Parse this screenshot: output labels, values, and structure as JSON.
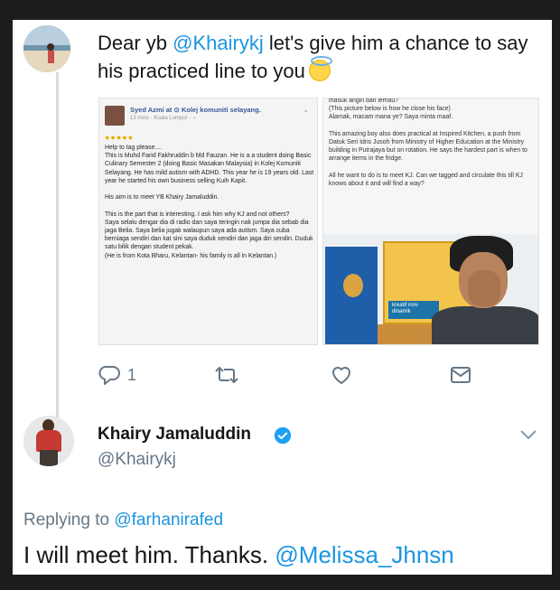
{
  "reply": {
    "text_before": "Dear yb ",
    "mention": "@Khairykj",
    "text_after": " let's give him a chance to say his practiced line to you"
  },
  "screenshot_left": {
    "author": "Syed Azmi at ⊙ Kolej komuniti selayang.",
    "meta": "13 mins · Kuala Lumpur · ♁",
    "body": "Help to tag please....\nThis is Muhd Farid Fakhruddin b Md Fauzan. He is a a student doing Basic Culinary Semester 2 (doing Basic Masakan Malaysia) in Kolej Komuniti Selayang. He has mild autism with ADHD. This year he is 19 years old. Last year he started his own business selling Kuih Kapit.\n\nHis aim is to meet YB Khairy Jamaluddin.\n\nThis is the part that is interesting. I ask him why KJ and not others?\nSaya selalu dengar dia di radio dan saya teringin nak jumpa dia sebab dia jaga Belia. Saya belia jugak walaupun saya ada autism. Saya cuba berniaga sendiri dan kat sini saya duduk sendiri dan jaga diri sendiri. Duduk satu bilik dengan student pekak.\n(He is from Kota Bharu, Kelantan- his family is all in Kelantan.)"
  },
  "screenshot_right": {
    "body": "masuk angin dan lemau?\n(This picture below is how he close his face)\nAlamak, macam mana ye? Saya minta maaf.\n\nThis amazing boy also does practical at Inspired Kitchen, a push from Datuk Seri Idris Jusoh from Ministry of Higher Education at the Ministry building in Putrajaya but on rotation. He says the hardest part is when to arrange items in the fridge.\n\nAll he want to do is to meet KJ. Can we tagged and circulate this till KJ knows about it and will find a way?",
    "photo_board_text": "kreatif inov\ndinamik"
  },
  "actions": {
    "reply_count": "1"
  },
  "main_tweet": {
    "name": "Khairy Jamaluddin",
    "handle": "@Khairykj",
    "replying_prefix": "Replying to ",
    "replying_to": "@farhanirafed",
    "text": "I will meet him. Thanks. ",
    "mention": "@Melissa_Jhnsn"
  },
  "colors": {
    "link": "#1b95e0",
    "muted": "#657786",
    "text": "#14171a",
    "verified": "#1da1f2"
  },
  "icons": [
    "reply-icon",
    "retweet-icon",
    "heart-icon",
    "message-icon",
    "verified-badge-icon",
    "chevron-down-icon",
    "halo-emoji-icon"
  ]
}
